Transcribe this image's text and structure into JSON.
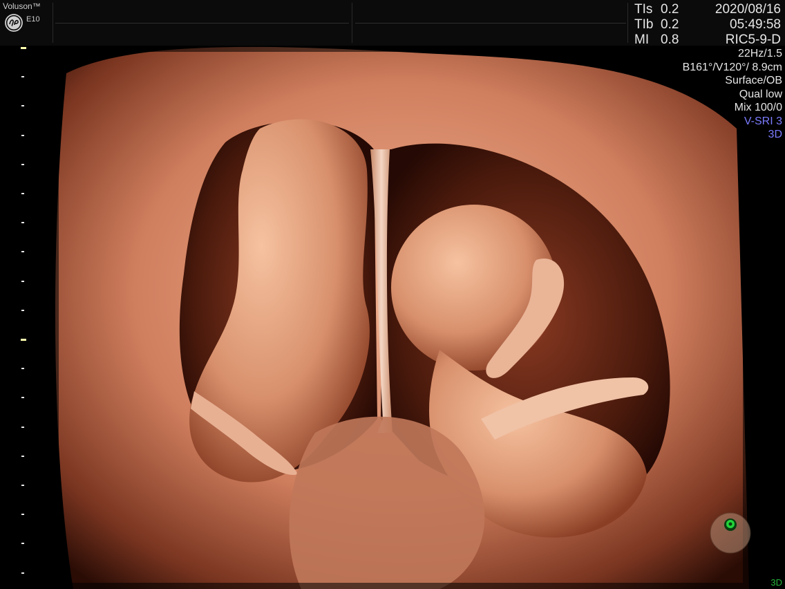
{
  "header": {
    "brand": "Voluson™",
    "model": "E10",
    "logo_icon": "ge-logo-icon"
  },
  "indices": [
    {
      "label": "TIs",
      "value": "0.2"
    },
    {
      "label": "TIb",
      "value": "0.2"
    },
    {
      "label": "MI",
      "value": "0.8"
    }
  ],
  "datetime": {
    "date": "2020/08/16",
    "time": "05:49:58",
    "probe": "RIC5-9-D"
  },
  "params": {
    "rate": "22Hz/1.5",
    "volume": "B161°/V120°/ 8.9cm",
    "render": "Surface/OB",
    "quality": "Qual low",
    "mix": "Mix 100/0",
    "vsri": "V-SRI 3",
    "view": "3D"
  },
  "mode_tag": "3D",
  "colors": {
    "accent_mode": "#7b7bff",
    "status_green": "#25b53a",
    "tissue": "#d98a6a"
  },
  "image": {
    "subject": "3D surface-rendered ultrasound of twin fetuses separated by a membrane"
  }
}
